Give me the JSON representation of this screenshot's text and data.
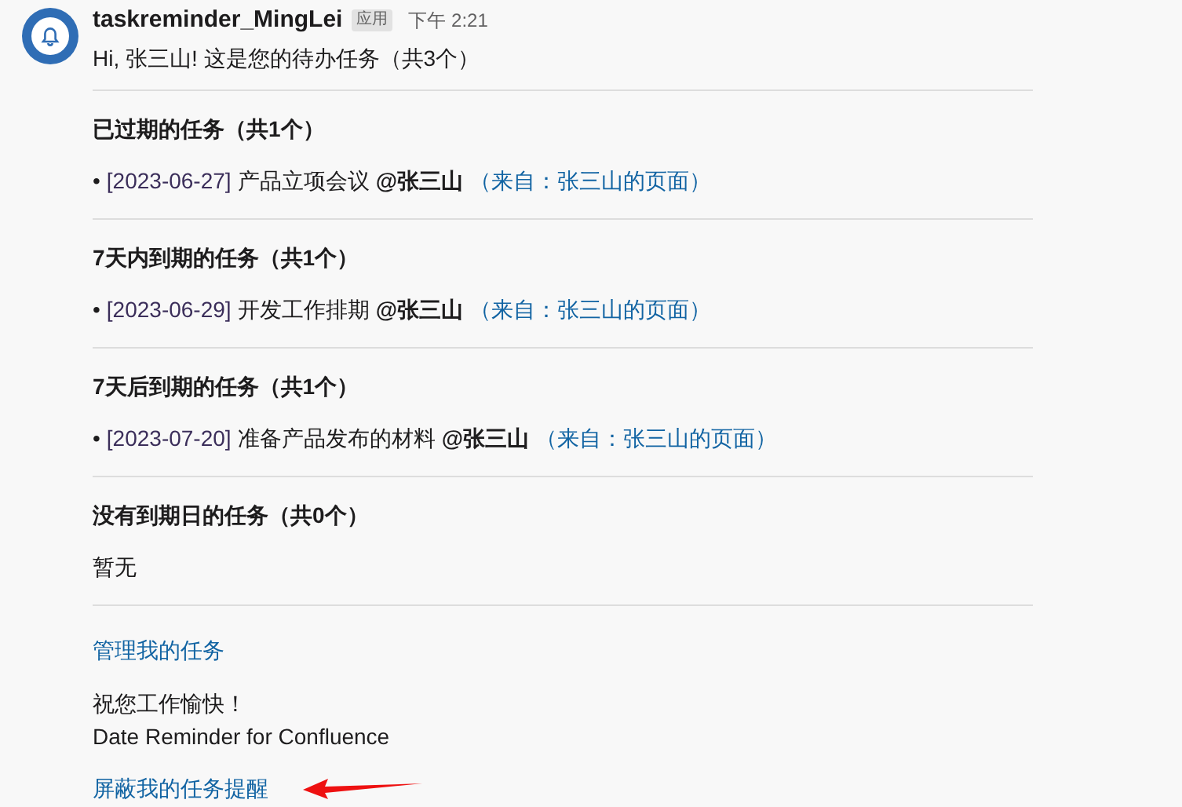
{
  "message": {
    "sender": "taskreminder_MingLei",
    "badge": "应用",
    "time": "下午 2:21",
    "greeting": "Hi, 张三山! 这是您的待办任务（共3个）"
  },
  "sections": [
    {
      "heading": "已过期的任务（共1个）",
      "items": [
        {
          "bullet": "•",
          "date": "[2023-06-27]",
          "title": "产品立项会议",
          "mention": "@张三山",
          "source": "（来自：张三山的页面）"
        }
      ]
    },
    {
      "heading": "7天内到期的任务（共1个）",
      "items": [
        {
          "bullet": "•",
          "date": "[2023-06-29]",
          "title": "开发工作排期",
          "mention": "@张三山",
          "source": "（来自：张三山的页面）"
        }
      ]
    },
    {
      "heading": "7天后到期的任务（共1个）",
      "items": [
        {
          "bullet": "•",
          "date": "[2023-07-20]",
          "title": "准备产品发布的材料",
          "mention": "@张三山",
          "source": "（来自：张三山的页面）"
        }
      ]
    },
    {
      "heading": "没有到期日的任务（共0个）",
      "empty": "暂无"
    }
  ],
  "manage_link": "管理我的任务",
  "closing": "祝您工作愉快！",
  "signature": "Date Reminder for Confluence",
  "mute_link": "屏蔽我的任务提醒"
}
